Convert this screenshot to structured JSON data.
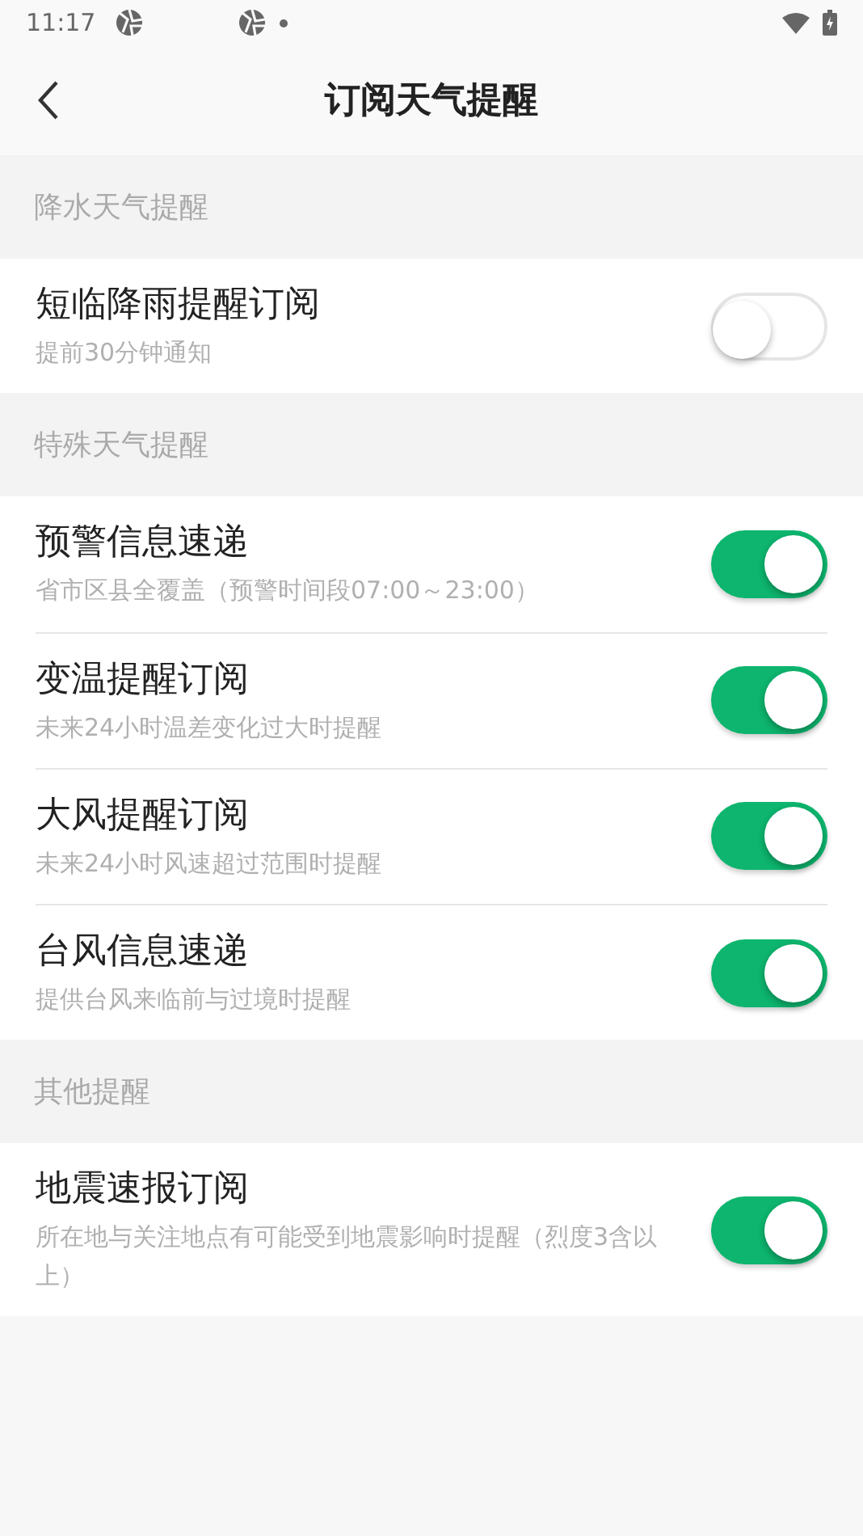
{
  "status_bar": {
    "time": "11:17"
  },
  "header": {
    "title": "订阅天气提醒"
  },
  "sections": [
    {
      "title": "降水天气提醒",
      "items": [
        {
          "title": "短临降雨提醒订阅",
          "subtitle": "提前30分钟通知",
          "on": false
        }
      ]
    },
    {
      "title": "特殊天气提醒",
      "items": [
        {
          "title": "预警信息速递",
          "subtitle": "省市区县全覆盖（预警时间段07:00～23:00）",
          "on": true
        },
        {
          "title": "变温提醒订阅",
          "subtitle": "未来24小时温差变化过大时提醒",
          "on": true
        },
        {
          "title": "大风提醒订阅",
          "subtitle": "未来24小时风速超过范围时提醒",
          "on": true
        },
        {
          "title": "台风信息速递",
          "subtitle": "提供台风来临前与过境时提醒",
          "on": true
        }
      ]
    },
    {
      "title": "其他提醒",
      "items": [
        {
          "title": "地震速报订阅",
          "subtitle": "所在地与关注地点有可能受到地震影响时提醒（烈度3含以上）",
          "on": true
        }
      ]
    }
  ]
}
